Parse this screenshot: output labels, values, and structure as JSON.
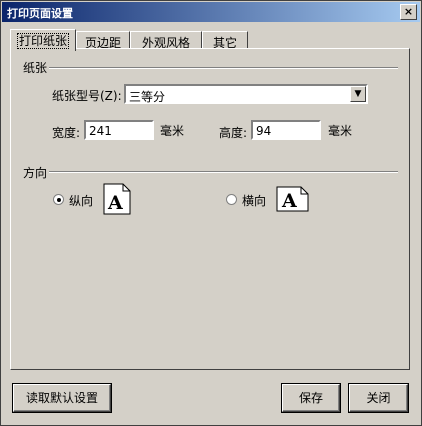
{
  "window": {
    "title": "打印页面设置",
    "close_glyph": "×"
  },
  "tabs": [
    {
      "label": "打印纸张",
      "active": true
    },
    {
      "label": "页边距",
      "active": false
    },
    {
      "label": "外观风格",
      "active": false
    },
    {
      "label": "其它",
      "active": false
    }
  ],
  "paper": {
    "section_title": "纸张",
    "type_label": "纸张型号(Z):",
    "type_value": "三等分",
    "width_label": "宽度:",
    "width_value": "241",
    "width_unit": "毫米",
    "height_label": "高度:",
    "height_value": "94",
    "height_unit": "毫米"
  },
  "orientation": {
    "section_title": "方向",
    "portrait_label": "纵向",
    "landscape_label": "横向",
    "selected": "portrait",
    "icon_letter": "A"
  },
  "buttons": {
    "defaults_label": "读取默认设置",
    "save_label": "保存",
    "close_label": "关闭"
  }
}
